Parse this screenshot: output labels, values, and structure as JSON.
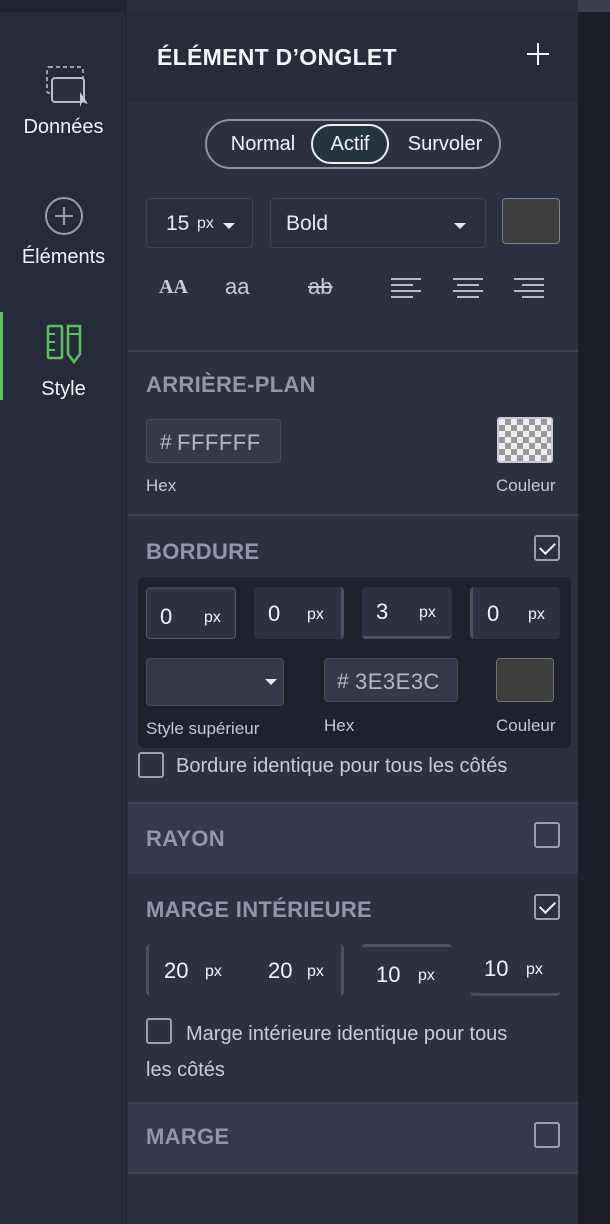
{
  "sidebar": {
    "items": [
      {
        "label": "Données",
        "icon": "data-selection-icon"
      },
      {
        "label": "Éléments",
        "icon": "plus-circle-icon"
      },
      {
        "label": "Style",
        "icon": "ruler-pencil-icon",
        "active": true
      }
    ],
    "accent_color": "#5fbf5f"
  },
  "panel": {
    "title": "ÉLÉMENT D’ONGLET",
    "add_icon": "plus-icon"
  },
  "states": {
    "options": [
      "Normal",
      "Actif",
      "Survoler"
    ],
    "selected": "Actif"
  },
  "text": {
    "font_size": "15",
    "font_size_unit": "px",
    "font_weight": "Bold",
    "color": "#3e3e3c",
    "uppercase": "AA",
    "lowercase": "aa",
    "strikethrough": "ab"
  },
  "background": {
    "title": "ARRIÈRE-PLAN",
    "hash": "#",
    "hex": "FFFFFF",
    "hex_label": "Hex",
    "color_label": "Couleur"
  },
  "border": {
    "title": "BORDURE",
    "enabled": true,
    "sides": [
      {
        "value": "0",
        "unit": "px"
      },
      {
        "value": "0",
        "unit": "px"
      },
      {
        "value": "3",
        "unit": "px"
      },
      {
        "value": "0",
        "unit": "px"
      }
    ],
    "style_label": "Style supérieur",
    "style_value": "",
    "hash": "#",
    "hex": "3E3E3C",
    "hex_label": "Hex",
    "color_label": "Couleur",
    "color": "#3e3e3c",
    "same_all_label": "Bordure identique pour tous les côtés"
  },
  "radius": {
    "title": "RAYON",
    "enabled": false
  },
  "padding": {
    "title": "MARGE INTÉRIEURE",
    "enabled": true,
    "sides": [
      {
        "value": "20",
        "unit": "px"
      },
      {
        "value": "20",
        "unit": "px"
      },
      {
        "value": "10",
        "unit": "px"
      },
      {
        "value": "10",
        "unit": "px"
      }
    ],
    "same_all_label_line1": "Marge intérieure identique pour tous",
    "same_all_label_line2": "les côtés"
  },
  "margin": {
    "title": "MARGE",
    "enabled": false
  }
}
